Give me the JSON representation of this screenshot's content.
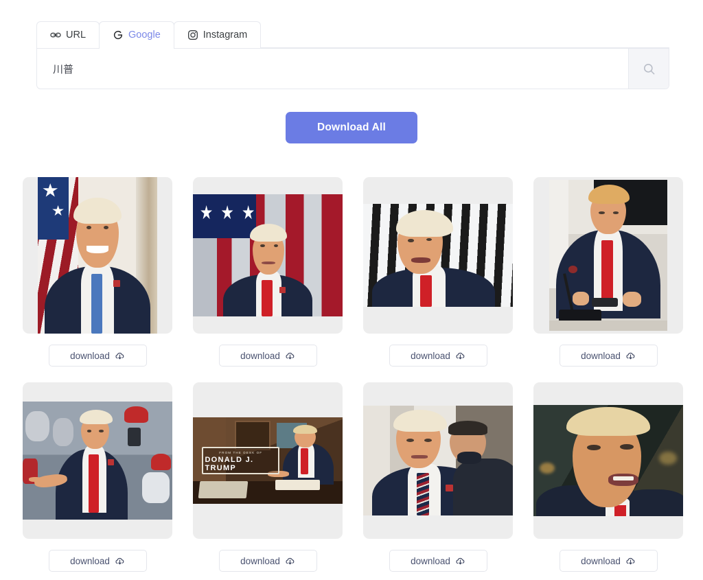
{
  "tabs": [
    {
      "id": "url",
      "label": "URL",
      "icon": "link-icon",
      "active": false
    },
    {
      "id": "google",
      "label": "Google",
      "icon": "google-g-icon",
      "active": true
    },
    {
      "id": "instagram",
      "label": "Instagram",
      "icon": "instagram-icon",
      "active": false
    }
  ],
  "search": {
    "value": "川普",
    "placeholder": "",
    "button_icon": "search-icon"
  },
  "actions": {
    "download_all_label": "Download All",
    "download_label": "download",
    "download_icon": "cloud-download-icon"
  },
  "colors": {
    "accent": "#6b7ce4",
    "active_tab_text": "#7b88e8",
    "card_bg": "#ededed",
    "page_bg": "#ffffff",
    "button_border": "#e4e6ec"
  },
  "results": [
    {
      "id": 1,
      "alt": "Official portrait smiling in front of American flag",
      "orientation": "portrait",
      "overlay_text": ""
    },
    {
      "id": 2,
      "alt": "Looking upward in front of large American flag",
      "orientation": "landscape",
      "overlay_text": ""
    },
    {
      "id": 3,
      "alt": "Speaking in front of black and white striped wall",
      "orientation": "landscape",
      "overlay_text": ""
    },
    {
      "id": 4,
      "alt": "Seated at desk reading with microphone",
      "orientation": "portrait",
      "overlay_text": ""
    },
    {
      "id": 5,
      "alt": "Pointing at a rally crowd",
      "orientation": "landscape",
      "overlay_text": ""
    },
    {
      "id": 6,
      "alt": "Writing at a desk with caption banner",
      "orientation": "landscape",
      "overlay_text": "FROM THE DESK OF DONALD J. TRUMP",
      "overlay_kicker": "FROM THE DESK OF",
      "overlay_name": "DONALD J. TRUMP"
    },
    {
      "id": 7,
      "alt": "Frowning with aide in background wearing mask",
      "orientation": "landscape",
      "overlay_text": ""
    },
    {
      "id": 8,
      "alt": "Close-up speaking with dark background",
      "orientation": "landscape",
      "overlay_text": ""
    }
  ]
}
